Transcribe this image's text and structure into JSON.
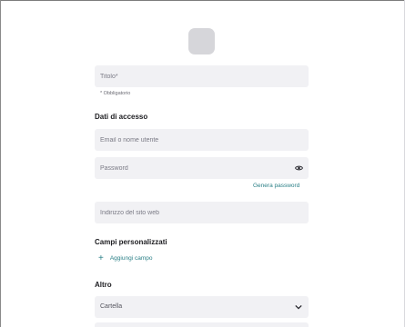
{
  "form": {
    "title_placeholder": "Titolo*",
    "required_hint": "* Obbligatorio",
    "access_section": "Dati di accesso",
    "username_placeholder": "Email o nome utente",
    "password_placeholder": "Password",
    "generate_password": "Genera password",
    "website_placeholder": "Indirizzo del sito web",
    "custom_fields_section": "Campi personalizzati",
    "add_field": "Aggiungi campo",
    "other_section": "Altro",
    "folder_select": "Cartella"
  },
  "icons": {
    "app_icon": "app-icon-placeholder",
    "password_toggle": "eye-icon",
    "add": "plus-icon",
    "dropdown": "chevron-down-icon"
  },
  "colors": {
    "accent": "#2a7f86",
    "field_bg": "#f1f1f4",
    "icon_placeholder": "#d6d6da"
  }
}
